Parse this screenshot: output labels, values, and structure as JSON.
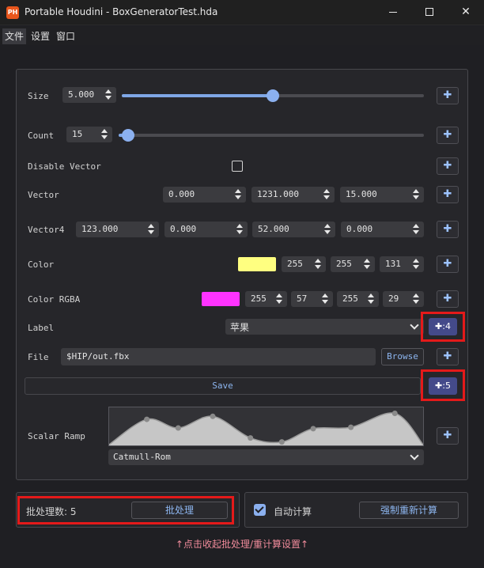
{
  "window": {
    "app_icon_text": "PH",
    "title": "Portable Houdini - BoxGeneratorTest.hda",
    "controls": [
      "minimize-icon",
      "maximize-icon",
      "close-icon"
    ]
  },
  "menu": {
    "file": "文件",
    "settings": "设置",
    "window": "窗口"
  },
  "params": {
    "size": {
      "label": "Size",
      "value": "5.000",
      "slider_fraction": 0.5
    },
    "count": {
      "label": "Count",
      "value": "15",
      "slider_fraction": 0.03
    },
    "disable_vector": {
      "label": "Disable Vector",
      "checked": false
    },
    "vector": {
      "label": "Vector",
      "values": [
        "0.000",
        "1231.000",
        "15.000"
      ]
    },
    "vector4": {
      "label": "Vector4",
      "values": [
        "123.000",
        "0.000",
        "52.000",
        "0.000"
      ]
    },
    "color": {
      "label": "Color",
      "swatch": "#ffff80",
      "values": [
        "255",
        "255",
        "131"
      ]
    },
    "color_rgba": {
      "label": "Color RGBA",
      "swatch": "#ff33ff",
      "values": [
        "255",
        "57",
        "255",
        "29"
      ]
    },
    "label": {
      "label": "Label",
      "selected": "苹果",
      "add_count": ":4"
    },
    "file": {
      "label": "File",
      "value": "$HIP/out.fbx",
      "browse": "Browse"
    },
    "save": {
      "label": "Save",
      "add_count": ":5"
    },
    "scalar_ramp": {
      "label": "Scalar Ramp",
      "interpolation": "Catmull-Rom",
      "points": [
        [
          0.12,
          0.76
        ],
        [
          0.22,
          0.5
        ],
        [
          0.33,
          0.85
        ],
        [
          0.45,
          0.2
        ],
        [
          0.55,
          0.08
        ],
        [
          0.65,
          0.48
        ],
        [
          0.77,
          0.52
        ],
        [
          0.91,
          0.94
        ]
      ]
    }
  },
  "plus_symbol": "✚",
  "batch": {
    "count_label": "批处理数: 5",
    "run_button": "批处理",
    "auto_compute_label": "自动计算",
    "auto_compute_checked": true,
    "force_button": "强制重新计算"
  },
  "collapse_hint": "↑点击收起批处理/重计算设置↑",
  "colors": {
    "accent": "#8bb0ef",
    "highlight_box": "#e41a1a",
    "count_button": "#444a8a",
    "hint_text": "#f08b9b"
  }
}
